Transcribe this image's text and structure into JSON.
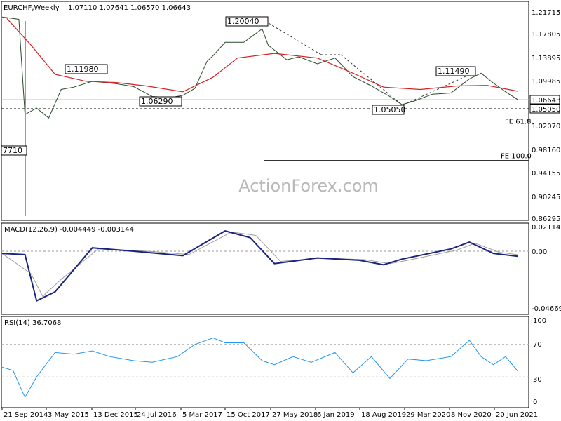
{
  "chart_data": [
    {
      "type": "ohlc_line",
      "title": "EURCHF,Weekly",
      "ohlc_text": "1.07110 1.07641 1.06570 1.06643",
      "watermark": "ActionForex.com",
      "ylim": [
        0.85,
        1.23
      ],
      "y_ticks": [
        "1.21715",
        "1.17805",
        "1.13895",
        "1.09985",
        "1.06643",
        "1.05050",
        "1.02070",
        "0.98160",
        "0.94155",
        "0.90245",
        "0.86295"
      ],
      "x_ticks": [
        "21 Sep 2014",
        "3 May 2015",
        "13 Dec 2015",
        "24 Jul 2016",
        "5 Mar 2017",
        "15 Oct 2017",
        "27 May 2018",
        "6 Jan 2019",
        "18 Aug 2019",
        "29 Mar 2020",
        "8 Nov 2020",
        "20 Jun 2021"
      ],
      "current_price": "1.06643",
      "support_level": "1.05050",
      "annotations": [
        "1.20040",
        "1.11980",
        "1.06290",
        "1.05050",
        "1.11490",
        "7710"
      ],
      "fib_lines": [
        {
          "label": "FE 61.8",
          "value": 1.0214
        },
        {
          "label": "FE 100.0",
          "value": 0.9624
        }
      ],
      "series": [
        {
          "name": "",
          "color": "#2a4a2a",
          "x": [
            "21 Sep 2014",
            "Dec 2014",
            "Jan 2015",
            "Mar 2015",
            "May 2015",
            "Jul 2015",
            "Sep 2015",
            "Dec 2015",
            "Apr 2016",
            "Jul 2016",
            "Oct 2016",
            "Jan 2017",
            "Mar 2017",
            "May 2017",
            "Jul 2017",
            "Aug 2017",
            "Oct 2017",
            "Jan 2018",
            "Apr 2018",
            "May 2018",
            "Aug 2018",
            "Oct 2018",
            "Jan 2019",
            "Apr 2019",
            "Jul 2019",
            "Oct 2019",
            "Jan 2020",
            "Mar 2020",
            "May 2020",
            "Aug 2020",
            "Nov 2020",
            "Feb 2021",
            "Apr 2021",
            "Jun 2021",
            "Aug 2021",
            "Oct 2021"
          ],
          "y": [
            1.2085,
            1.2045,
            1.041,
            1.052,
            1.035,
            1.084,
            1.088,
            1.098,
            1.094,
            1.089,
            1.072,
            1.07,
            1.074,
            1.086,
            1.132,
            1.142,
            1.165,
            1.165,
            1.188,
            1.16,
            1.135,
            1.14,
            1.128,
            1.138,
            1.106,
            1.09,
            1.072,
            1.058,
            1.064,
            1.076,
            1.078,
            1.102,
            1.112,
            1.095,
            1.08,
            1.0664
          ]
        },
        {
          "name": "",
          "color": "#d62020",
          "x": [
            "Oct 2014",
            "Feb 2015",
            "Jun 2015",
            "Nov 2015",
            "Apr 2016",
            "Sep 2016",
            "Mar 2017",
            "Aug 2017",
            "Dec 2017",
            "Jun 2018",
            "Jan 2019",
            "Jul 2019",
            "Dec 2019",
            "Jun 2020",
            "Dec 2020",
            "May 2021",
            "Oct 2021"
          ],
          "y": [
            1.206,
            1.16,
            1.11,
            1.098,
            1.096,
            1.09,
            1.08,
            1.105,
            1.138,
            1.146,
            1.138,
            1.112,
            1.088,
            1.084,
            1.09,
            1.091,
            1.081
          ]
        }
      ]
    },
    {
      "type": "line",
      "title": "MACD(12,26,9) -0.004449 -0.003144",
      "ylim": [
        -0.0467,
        0.0211
      ],
      "y_ticks": [
        "0.021146",
        "0.00",
        "-0.046699"
      ],
      "series": [
        {
          "name": "",
          "color": "#1a237e",
          "x": [
            "21 Sep 2014",
            "Jan 2015",
            "Mar 2015",
            "Jun 2015",
            "Dec 2015",
            "Jul 2016",
            "Mar 2017",
            "Oct 2017",
            "Feb 2018",
            "Jun 2018",
            "Jan 2019",
            "Aug 2019",
            "Dec 2019",
            "Mar 2020",
            "Nov 2020",
            "Feb 2021",
            "Jun 2021",
            "Oct 2021"
          ],
          "y": [
            -0.002,
            -0.003,
            -0.044,
            -0.036,
            0.003,
            0.0,
            -0.004,
            0.018,
            0.012,
            -0.011,
            -0.006,
            -0.008,
            -0.012,
            -0.007,
            0.002,
            0.008,
            -0.002,
            -0.0045
          ]
        },
        {
          "name": "",
          "color": "#9e9e9e",
          "x": [
            "21 Sep 2014",
            "Feb 2015",
            "Apr 2015",
            "Jul 2015",
            "Jan 2016",
            "Aug 2016",
            "Apr 2017",
            "Nov 2017",
            "Mar 2018",
            "Jul 2018",
            "Feb 2019",
            "Sep 2019",
            "Jan 2020",
            "Apr 2020",
            "Dec 2020",
            "Mar 2021",
            "Jul 2021",
            "Oct 2021"
          ],
          "y": [
            -0.002,
            -0.02,
            -0.04,
            -0.025,
            0.002,
            0.0005,
            -0.003,
            0.017,
            0.014,
            -0.009,
            -0.006,
            -0.0075,
            -0.011,
            -0.008,
            0.001,
            0.007,
            -0.001,
            -0.0031
          ]
        }
      ]
    },
    {
      "type": "line",
      "title": "RSI(14) 36.7068",
      "ylim": [
        0,
        100
      ],
      "y_ticks": [
        "100",
        "70",
        "30",
        "0"
      ],
      "levels": [
        70,
        30
      ],
      "series": [
        {
          "name": "",
          "color": "#2196f3",
          "x": [
            "21 Sep 2014",
            "Nov 2014",
            "Jan 2015",
            "Mar 2015",
            "Jun 2015",
            "Sep 2015",
            "Dec 2015",
            "Mar 2016",
            "Jul 2016",
            "Oct 2016",
            "Feb 2017",
            "May 2017",
            "Aug 2017",
            "Oct 2017",
            "Jan 2018",
            "Apr 2018",
            "Jun 2018",
            "Sep 2018",
            "Dec 2018",
            "Apr 2019",
            "Jul 2019",
            "Oct 2019",
            "Jan 2020",
            "Apr 2020",
            "Jul 2020",
            "Nov 2020",
            "Feb 2021",
            "Apr 2021",
            "Jun 2021",
            "Aug 2021",
            "Oct 2021"
          ],
          "y": [
            42,
            38,
            5,
            30,
            60,
            58,
            62,
            55,
            50,
            48,
            55,
            70,
            78,
            72,
            72,
            50,
            45,
            55,
            48,
            60,
            35,
            55,
            28,
            52,
            50,
            55,
            75,
            55,
            45,
            55,
            37
          ]
        }
      ]
    }
  ]
}
